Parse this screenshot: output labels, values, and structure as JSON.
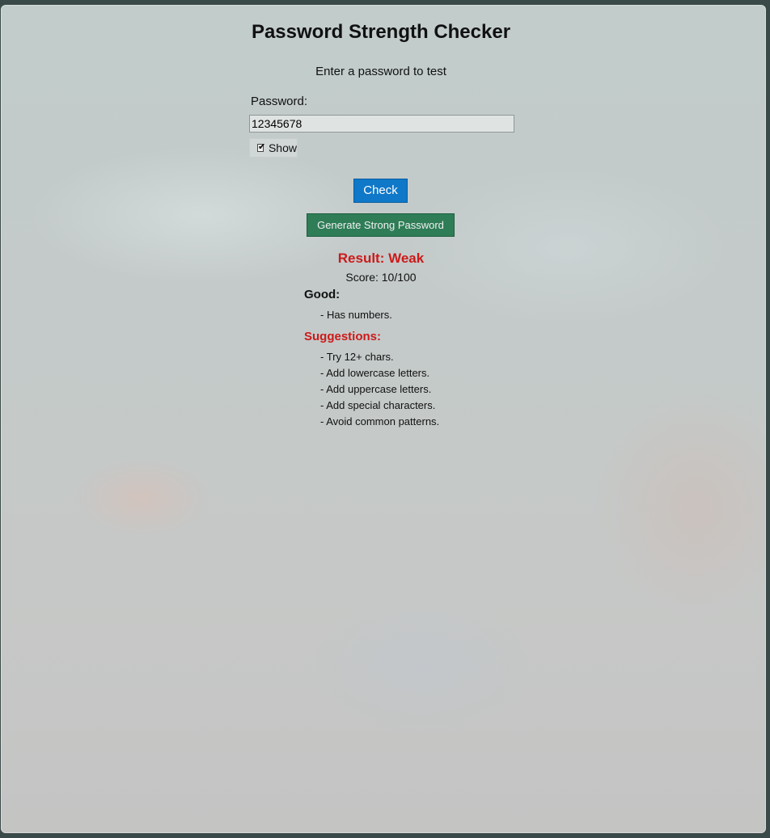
{
  "app": {
    "title": "Password Strength Checker",
    "subtitle": "Enter a password to test"
  },
  "form": {
    "password_label": "Password:",
    "password_value": "12345678",
    "show_checked": true,
    "show_label": "Show",
    "check_button": "Check",
    "generate_button": "Generate Strong Password"
  },
  "result": {
    "heading": "Result: Weak",
    "score_text": "Score: 10/100",
    "good_heading": "Good:",
    "good_items": [
      "- Has numbers."
    ],
    "suggestions_heading": "Suggestions:",
    "suggestions": [
      "- Try 12+ chars.",
      "- Add lowercase letters.",
      "- Add uppercase letters.",
      "- Add special characters.",
      "- Avoid common patterns."
    ]
  },
  "colors": {
    "check_button": "#0f78c8",
    "generate_button": "#2e7d57",
    "weak_result": "#cc1a1a"
  },
  "icons": {
    "checkbox": "check-icon"
  }
}
